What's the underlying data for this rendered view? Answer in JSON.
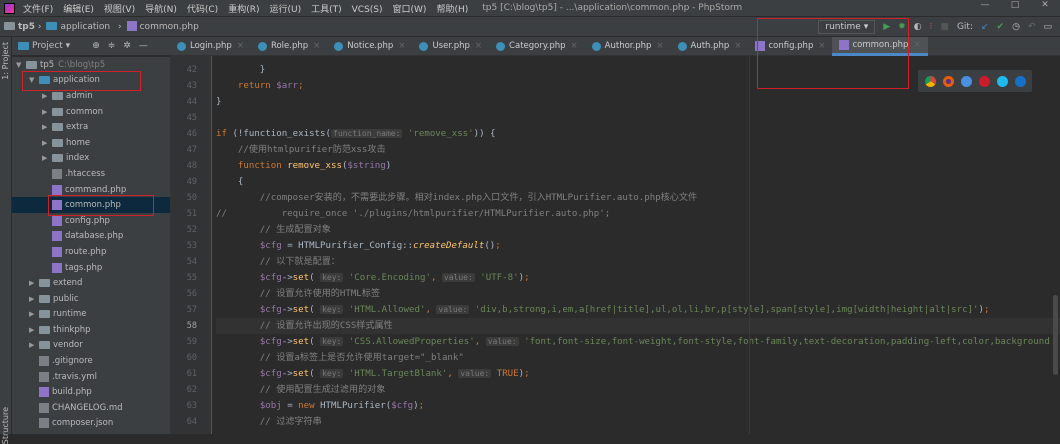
{
  "titlebar": {
    "menu": [
      "文件(F)",
      "编辑(E)",
      "视图(V)",
      "导航(N)",
      "代码(C)",
      "重构(R)",
      "运行(U)",
      "工具(T)",
      "VCS(S)",
      "窗口(W)",
      "帮助(H)"
    ],
    "title": "tp5 [C:\\blog\\tp5] - ...\\application\\common.php - PhpStorm"
  },
  "breadcrumb": [
    "tp5",
    "application",
    "common.php"
  ],
  "toolbar": {
    "run_config": "runtime",
    "git_label": "Git:"
  },
  "stripe": {
    "project": "1: Project",
    "structure": "Structure"
  },
  "project": {
    "title": "Project"
  },
  "tree": [
    {
      "label": "tp5",
      "hint": "C:\\blog\\tp5",
      "depth": 0,
      "type": "folder",
      "open": true
    },
    {
      "label": "application",
      "depth": 1,
      "type": "folder-blue",
      "open": true
    },
    {
      "label": "admin",
      "depth": 2,
      "type": "folder"
    },
    {
      "label": "common",
      "depth": 2,
      "type": "folder"
    },
    {
      "label": "extra",
      "depth": 2,
      "type": "folder"
    },
    {
      "label": "home",
      "depth": 2,
      "type": "folder"
    },
    {
      "label": "index",
      "depth": 2,
      "type": "folder"
    },
    {
      "label": ".htaccess",
      "depth": 2,
      "type": "file"
    },
    {
      "label": "command.php",
      "depth": 2,
      "type": "php"
    },
    {
      "label": "common.php",
      "depth": 2,
      "type": "php",
      "selected": true
    },
    {
      "label": "config.php",
      "depth": 2,
      "type": "php"
    },
    {
      "label": "database.php",
      "depth": 2,
      "type": "php"
    },
    {
      "label": "route.php",
      "depth": 2,
      "type": "php"
    },
    {
      "label": "tags.php",
      "depth": 2,
      "type": "php"
    },
    {
      "label": "extend",
      "depth": 1,
      "type": "folder"
    },
    {
      "label": "public",
      "depth": 1,
      "type": "folder"
    },
    {
      "label": "runtime",
      "depth": 1,
      "type": "folder"
    },
    {
      "label": "thinkphp",
      "depth": 1,
      "type": "folder"
    },
    {
      "label": "vendor",
      "depth": 1,
      "type": "folder"
    },
    {
      "label": ".gitignore",
      "depth": 1,
      "type": "file"
    },
    {
      "label": ".travis.yml",
      "depth": 1,
      "type": "file"
    },
    {
      "label": "build.php",
      "depth": 1,
      "type": "php"
    },
    {
      "label": "CHANGELOG.md",
      "depth": 1,
      "type": "file"
    },
    {
      "label": "composer.json",
      "depth": 1,
      "type": "file"
    }
  ],
  "tabs": [
    {
      "label": "Login.php",
      "type": "class"
    },
    {
      "label": "Role.php",
      "type": "class"
    },
    {
      "label": "Notice.php",
      "type": "class"
    },
    {
      "label": "User.php",
      "type": "class"
    },
    {
      "label": "Category.php",
      "type": "class"
    },
    {
      "label": "Author.php",
      "type": "class"
    },
    {
      "label": "Auth.php",
      "type": "class"
    },
    {
      "label": "config.php",
      "type": "php"
    },
    {
      "label": "common.php",
      "type": "php",
      "active": true
    }
  ],
  "editor": {
    "current_line": 58,
    "lines": [
      {
        "n": 42,
        "s": [
          [
            "        }",
            ""
          ]
        ]
      },
      {
        "n": 43,
        "s": [
          [
            "    ",
            ""
          ],
          [
            "return ",
            "kw"
          ],
          [
            "$arr",
            "vr"
          ],
          [
            ";",
            "kw"
          ]
        ]
      },
      {
        "n": 44,
        "s": [
          [
            "}",
            ""
          ]
        ]
      },
      {
        "n": 45,
        "s": []
      },
      {
        "n": 46,
        "s": [
          [
            "if ",
            "kw"
          ],
          [
            "(!function_exists(",
            ""
          ],
          [
            "function_name:",
            "hn"
          ],
          [
            " ",
            ""
          ],
          [
            "'remove_xss'",
            "st"
          ],
          [
            ")) {",
            ""
          ]
        ]
      },
      {
        "n": 47,
        "s": [
          [
            "    //使用htmlpurifier防范xss攻击",
            "cm"
          ]
        ]
      },
      {
        "n": 48,
        "s": [
          [
            "    ",
            ""
          ],
          [
            "function ",
            "kw"
          ],
          [
            "remove_xss",
            "fn"
          ],
          [
            "(",
            ""
          ],
          [
            "$string",
            "vr"
          ],
          [
            ")",
            ""
          ]
        ]
      },
      {
        "n": 49,
        "s": [
          [
            "    {",
            ""
          ]
        ]
      },
      {
        "n": 50,
        "s": [
          [
            "        //composer安装的，不需要此步骤。相对index.php入口文件，引入HTMLPurifier.auto.php核心文件",
            "cm"
          ]
        ]
      },
      {
        "n": 51,
        "s": [
          [
            "//          require_once './plugins/htmlpurifier/HTMLPurifier.auto.php';",
            "cm"
          ]
        ]
      },
      {
        "n": 52,
        "s": [
          [
            "        // 生成配置对象",
            "cm"
          ]
        ]
      },
      {
        "n": 53,
        "s": [
          [
            "        ",
            ""
          ],
          [
            "$cfg",
            "vr"
          ],
          [
            " = HTMLPurifier_Config::",
            ""
          ],
          [
            "createDefault",
            "it"
          ],
          [
            "()",
            ""
          ],
          [
            ";",
            "kw"
          ]
        ]
      },
      {
        "n": 54,
        "s": [
          [
            "        // 以下就是配置：",
            "cm"
          ]
        ]
      },
      {
        "n": 55,
        "s": [
          [
            "        ",
            ""
          ],
          [
            "$cfg",
            "vr"
          ],
          [
            "->",
            ""
          ],
          [
            "set",
            "fn"
          ],
          [
            "( ",
            ""
          ],
          [
            "key:",
            "hn"
          ],
          [
            " ",
            ""
          ],
          [
            "'Core.Encoding'",
            "st"
          ],
          [
            ", ",
            "kw"
          ],
          [
            "value:",
            "hn"
          ],
          [
            " ",
            ""
          ],
          [
            "'UTF-8'",
            "st"
          ],
          [
            ")",
            ""
          ],
          [
            ";",
            "kw"
          ]
        ]
      },
      {
        "n": 56,
        "s": [
          [
            "        // 设置允许使用的HTML标签",
            "cm"
          ]
        ]
      },
      {
        "n": 57,
        "s": [
          [
            "        ",
            ""
          ],
          [
            "$cfg",
            "vr"
          ],
          [
            "->",
            ""
          ],
          [
            "set",
            "fn"
          ],
          [
            "( ",
            ""
          ],
          [
            "key:",
            "hn"
          ],
          [
            " ",
            ""
          ],
          [
            "'HTML.Allowed'",
            "st"
          ],
          [
            ", ",
            "kw"
          ],
          [
            "value:",
            "hn"
          ],
          [
            " ",
            ""
          ],
          [
            "'div,b,strong,i,em,a[href|title],ul,ol,li,br,p[style],span[style],img[width|height|alt|src]'",
            "st"
          ],
          [
            ")",
            ""
          ],
          [
            ";",
            "kw"
          ]
        ]
      },
      {
        "n": 58,
        "s": [
          [
            "        // 设置允许出现的CSS样式属性",
            "cm"
          ]
        ]
      },
      {
        "n": 59,
        "s": [
          [
            "        ",
            ""
          ],
          [
            "$cfg",
            "vr"
          ],
          [
            "->",
            ""
          ],
          [
            "set",
            "fn"
          ],
          [
            "( ",
            ""
          ],
          [
            "key:",
            "hn"
          ],
          [
            " ",
            ""
          ],
          [
            "'CSS.AllowedProperties'",
            "st"
          ],
          [
            ", ",
            "kw"
          ],
          [
            "value:",
            "hn"
          ],
          [
            " ",
            ""
          ],
          [
            "'font,font-size,font-weight,font-style,font-family,text-decoration,padding-left,color,background",
            "st"
          ]
        ]
      },
      {
        "n": 60,
        "s": [
          [
            "        // 设置a标签上是否允许使用target=\"_blank\"",
            "cm"
          ]
        ]
      },
      {
        "n": 61,
        "s": [
          [
            "        ",
            ""
          ],
          [
            "$cfg",
            "vr"
          ],
          [
            "->",
            ""
          ],
          [
            "set",
            "fn"
          ],
          [
            "( ",
            ""
          ],
          [
            "key:",
            "hn"
          ],
          [
            " ",
            ""
          ],
          [
            "'HTML.TargetBlank'",
            "st"
          ],
          [
            ", ",
            "kw"
          ],
          [
            "value:",
            "hn"
          ],
          [
            " ",
            ""
          ],
          [
            "TRUE",
            "kw"
          ],
          [
            ")",
            ""
          ],
          [
            ";",
            "kw"
          ]
        ]
      },
      {
        "n": 62,
        "s": [
          [
            "        // 使用配置生成过滤用的对象",
            "cm"
          ]
        ]
      },
      {
        "n": 63,
        "s": [
          [
            "        ",
            ""
          ],
          [
            "$obj",
            "vr"
          ],
          [
            " = ",
            ""
          ],
          [
            "new ",
            "kw"
          ],
          [
            "HTMLPurifier(",
            ""
          ],
          [
            "$cfg",
            "vr"
          ],
          [
            ")",
            ""
          ],
          [
            ";",
            "kw"
          ]
        ]
      },
      {
        "n": 64,
        "s": [
          [
            "        // 过滤字符串",
            "cm"
          ]
        ]
      }
    ]
  },
  "browsers": [
    "chrome",
    "firefox",
    "safari",
    "opera",
    "ie",
    "edge"
  ],
  "colors": {
    "highlight": "#d0202a",
    "bg": "#2b2b2b",
    "panel": "#3c3f41"
  }
}
